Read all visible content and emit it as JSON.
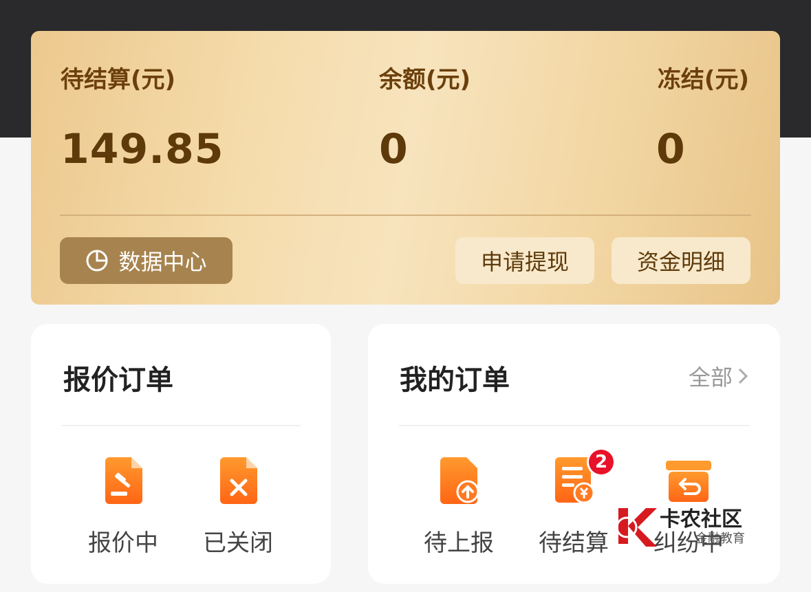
{
  "wallet": {
    "pending_label": "待结算(元)",
    "pending_value": "149.85",
    "balance_label": "余额(元)",
    "balance_value": "0",
    "frozen_label": "冻结(元)",
    "frozen_value": "0",
    "data_center_label": "数据中心",
    "withdraw_label": "申请提现",
    "fund_detail_label": "资金明细"
  },
  "quote_orders": {
    "title": "报价订单",
    "items": [
      {
        "label": "报价中",
        "icon": "gavel-document-icon"
      },
      {
        "label": "已关闭",
        "icon": "closed-document-icon"
      }
    ]
  },
  "my_orders": {
    "title": "我的订单",
    "more_label": "全部",
    "items": [
      {
        "label": "待上报",
        "icon": "upload-document-icon"
      },
      {
        "label": "待结算",
        "icon": "settlement-list-icon",
        "badge": "2"
      },
      {
        "label": "纠纷中",
        "icon": "return-box-icon"
      }
    ]
  },
  "watermark": {
    "text": "卡农社区",
    "sub": "金融教育"
  },
  "colors": {
    "accent_orange": "#ff6a1a",
    "gold_text": "#5e3a0a",
    "badge_red": "#e8122a"
  }
}
